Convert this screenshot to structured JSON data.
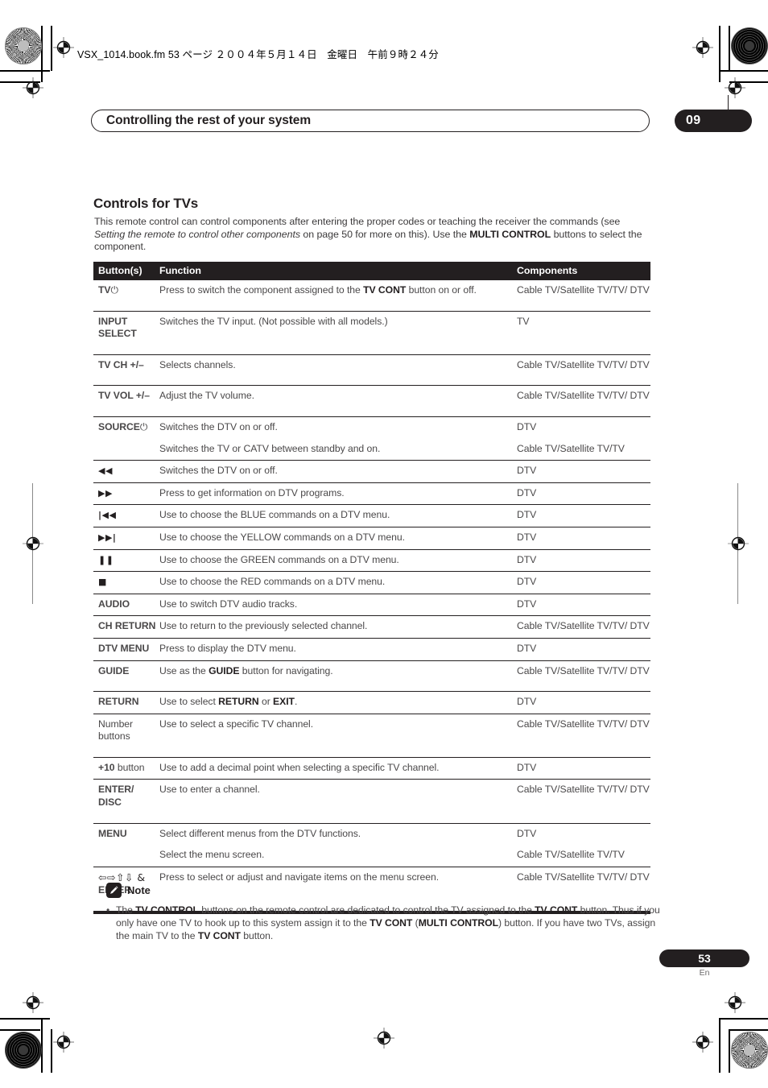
{
  "file_header": "VSX_1014.book.fm 53 ページ ２００４年５月１４日　金曜日　午前９時２４分",
  "running_header": {
    "title": "Controlling the rest of your system",
    "chapter_badge": "09"
  },
  "section": {
    "title": "Controls for TVs",
    "intro_1": "This remote control can control components after entering the proper codes or teaching the receiver the commands (see ",
    "intro_italic": "Setting the remote to control other components",
    "intro_2": " on page 50 for more on this). Use the ",
    "intro_bold": "MULTI CONTROL",
    "intro_3": " buttons to select the component."
  },
  "table": {
    "headers": {
      "buttons": "Button(s)",
      "function": "Function",
      "components": "Components"
    },
    "rows": [
      {
        "button_text": "TV",
        "button_glyph": "⏻",
        "button_kind": "power",
        "function_pre": "Press to switch the component assigned to the ",
        "function_bold": "TV CONT",
        "function_post": " button on or off.",
        "components": "Cable TV/Satellite TV/TV/ DTV",
        "separator": true,
        "tall": true
      },
      {
        "button_text": "INPUT SELECT",
        "button_kind": "bold-two-line",
        "function_pre": "Switches the TV input. (Not possible with all models.)",
        "components": "TV",
        "separator": true,
        "tall": true
      },
      {
        "button_text": "TV CH +/–",
        "button_kind": "bold",
        "function_pre": "Selects channels.",
        "components": "Cable TV/Satellite TV/TV/ DTV",
        "separator": true,
        "tall": true
      },
      {
        "button_text": "TV VOL +/–",
        "button_kind": "bold",
        "function_pre": "Adjust the TV volume.",
        "components": "Cable TV/Satellite TV/TV/ DTV",
        "separator": true,
        "tall": true
      },
      {
        "button_text": "SOURCE",
        "button_glyph": "⏻",
        "button_kind": "power",
        "function_pre": "Switches the DTV on or off.",
        "components": "DTV",
        "separator": true,
        "tall": false
      },
      {
        "button_text": "",
        "button_kind": "bold",
        "function_pre": "Switches the TV or CATV between standby and on.",
        "components": "Cable TV/Satellite TV/TV",
        "separator": false,
        "tall": false
      },
      {
        "button_text": "◀◀",
        "button_kind": "glyph",
        "function_pre": "Switches the DTV on or off.",
        "components": "DTV",
        "separator": true,
        "tall": false
      },
      {
        "button_text": "▶▶",
        "button_kind": "glyph",
        "function_pre": "Press to get information on DTV programs.",
        "components": "DTV",
        "separator": true,
        "tall": false
      },
      {
        "button_text": "|◀◀",
        "button_kind": "glyph",
        "function_pre": "Use to choose the BLUE commands on a DTV menu.",
        "components": "DTV",
        "separator": true,
        "tall": false
      },
      {
        "button_text": "▶▶|",
        "button_kind": "glyph",
        "function_pre": "Use to choose the YELLOW commands on a DTV menu.",
        "components": "DTV",
        "separator": true,
        "tall": false
      },
      {
        "button_text": "❚❚",
        "button_kind": "glyph",
        "function_pre": "Use to choose the GREEN commands on a DTV menu.",
        "components": "DTV",
        "separator": true,
        "tall": false
      },
      {
        "button_text": "■",
        "button_kind": "glyph",
        "function_pre": "Use to choose the RED commands on a DTV menu.",
        "components": "DTV",
        "separator": true,
        "tall": false
      },
      {
        "button_text": "AUDIO",
        "button_kind": "bold",
        "function_pre": "Use to switch DTV audio tracks.",
        "components": "DTV",
        "separator": true,
        "tall": false
      },
      {
        "button_text": "CH RETURN",
        "button_kind": "bold",
        "function_pre": "Use to return to the previously selected channel.",
        "components": "Cable TV/Satellite TV/TV/ DTV",
        "separator": true,
        "tall": false
      },
      {
        "button_text": "DTV MENU",
        "button_kind": "bold",
        "function_pre": "Press to display the DTV menu.",
        "components": "DTV",
        "separator": true,
        "tall": false
      },
      {
        "button_text": "GUIDE",
        "button_kind": "bold",
        "function_pre": "Use as the ",
        "function_bold": "GUIDE",
        "function_post": " button for navigating.",
        "components": "Cable TV/Satellite TV/TV/ DTV",
        "separator": true,
        "tall": true
      },
      {
        "button_text": "RETURN",
        "button_kind": "bold",
        "function_pre": "Use to select ",
        "function_bold": "RETURN",
        "function_mid": " or ",
        "function_bold2": "EXIT",
        "function_post": ".",
        "components": "DTV",
        "separator": true,
        "tall": false
      },
      {
        "button_text": "Number buttons",
        "button_kind": "regular-two-line",
        "function_pre": "Use to select a specific TV channel.",
        "components": "Cable TV/Satellite TV/TV/ DTV",
        "separator": true,
        "tall": true
      },
      {
        "button_text": "+10",
        "button_suffix": " button",
        "button_kind": "bold-suffix",
        "function_pre": "Use to add a decimal point when selecting a specific TV channel.",
        "components": "DTV",
        "separator": true,
        "tall": false
      },
      {
        "button_text": "ENTER/ DISC",
        "button_kind": "bold-two-line",
        "function_pre": "Use to enter a channel.",
        "components": "Cable TV/Satellite TV/TV/ DTV",
        "separator": true,
        "tall": true
      },
      {
        "button_text": "MENU",
        "button_kind": "bold",
        "function_pre": "Select different menus from the DTV functions.",
        "components": "DTV",
        "separator": true,
        "tall": false
      },
      {
        "button_text": "",
        "button_kind": "bold",
        "function_pre": "Select the menu screen.",
        "components": "Cable TV/Satellite TV/TV",
        "separator": false,
        "tall": false
      },
      {
        "button_text": "⇦⇨⇧⇩ &",
        "button_second_line": "ENTER",
        "button_kind": "arrows",
        "function_pre": "Press to select or adjust and navigate items on the menu screen.",
        "components": "Cable TV/Satellite TV/TV/ DTV",
        "separator": true,
        "tall": true,
        "last": true
      }
    ]
  },
  "note": {
    "label": "Note",
    "bullet": "•",
    "parts": [
      {
        "text": "The ",
        "bold": false
      },
      {
        "text": "TV CONTROL",
        "bold": true
      },
      {
        "text": " buttons on the remote control are dedicated to control the TV assigned to the ",
        "bold": false
      },
      {
        "text": "TV CONT",
        "bold": true
      },
      {
        "text": " button. Thus if you only have one TV to hook up to this system assign it to the ",
        "bold": false
      },
      {
        "text": "TV CONT",
        "bold": true
      },
      {
        "text": " (",
        "bold": false
      },
      {
        "text": "MULTI CONTROL",
        "bold": true
      },
      {
        "text": ") button. If you have two TVs, assign the main TV to the ",
        "bold": false
      },
      {
        "text": "TV CONT",
        "bold": true
      },
      {
        "text": " button.",
        "bold": false
      }
    ]
  },
  "footer": {
    "page_number": "53",
    "language": "En"
  },
  "colors": {
    "ink": "#231f20",
    "body_text": "#4a4849"
  }
}
